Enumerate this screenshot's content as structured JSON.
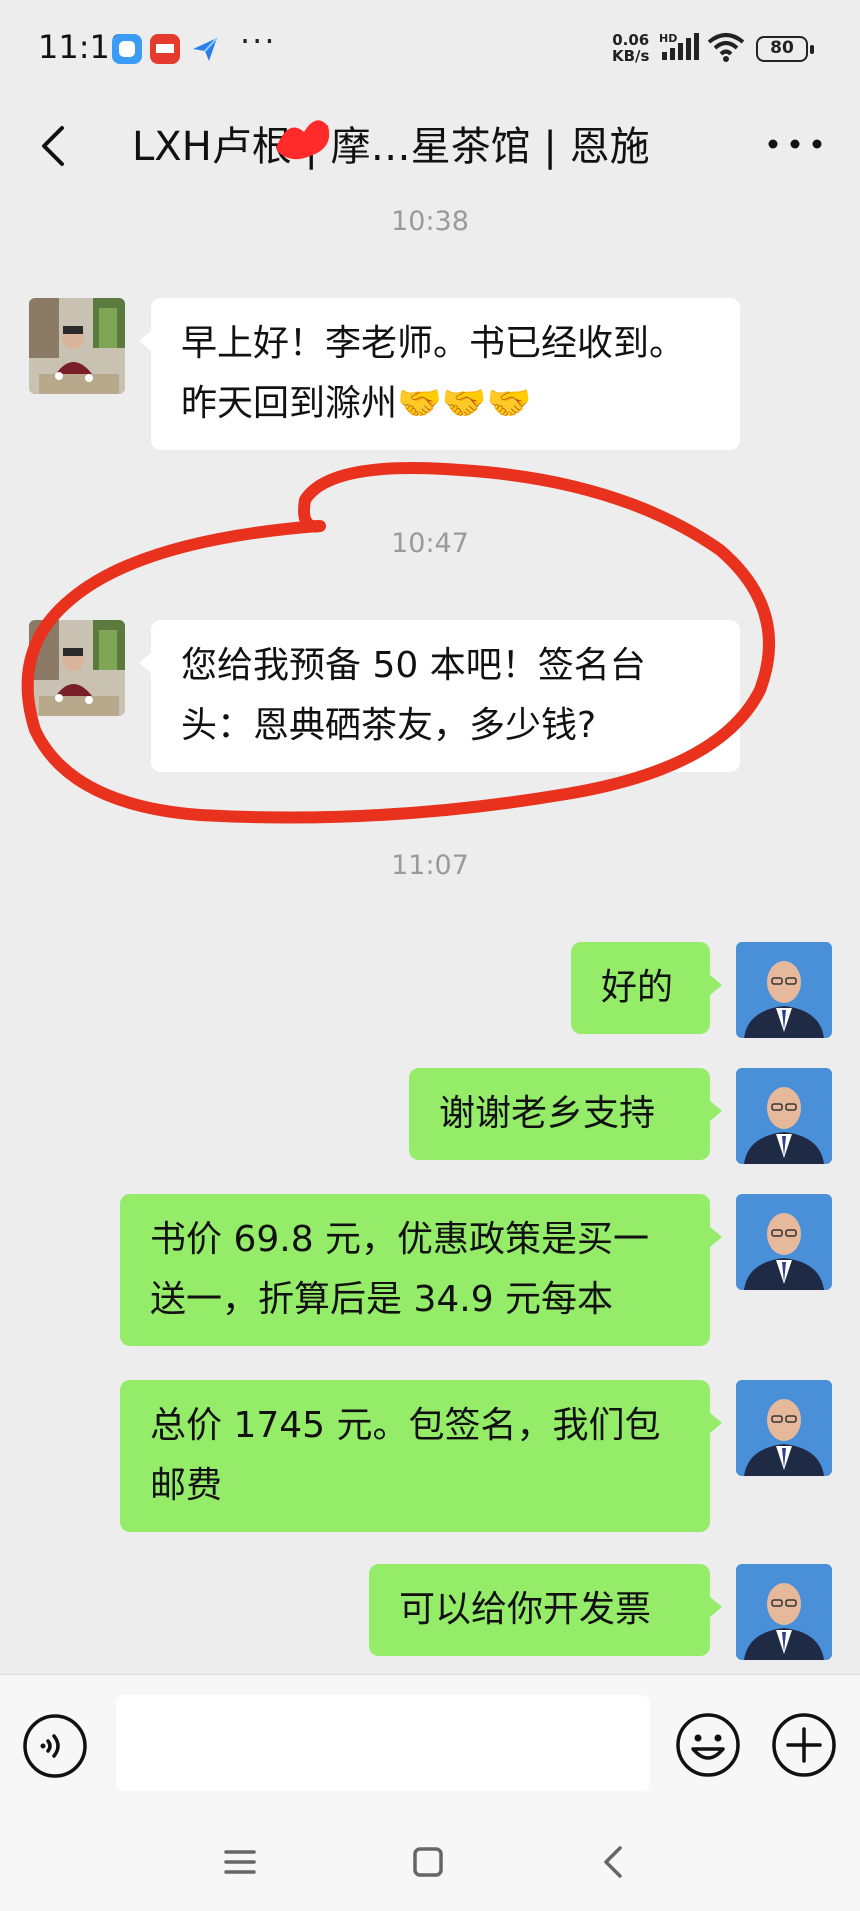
{
  "status_bar": {
    "time": "11:18",
    "speed_value": "0.06",
    "speed_unit": "KB/s",
    "network_badge": "HD",
    "battery": "80"
  },
  "header": {
    "title": "LXH卢根 | 摩…星茶馆 | 恩施"
  },
  "messages": [
    {
      "type": "time",
      "text": "10:38"
    },
    {
      "type": "in",
      "text": "早上好！李老师。书已经收到。\n昨天回到滁州🤝🤝🤝"
    },
    {
      "type": "time",
      "text": "10:47"
    },
    {
      "type": "in",
      "text": "您给我预备 50 本吧！签名台\n头：恩典硒茶友，多少钱?"
    },
    {
      "type": "time",
      "text": "11:07"
    },
    {
      "type": "out",
      "text": "好的"
    },
    {
      "type": "out",
      "text": "谢谢老乡支持"
    },
    {
      "type": "out",
      "text": "书价 69.8 元，优惠政策是买一\n送一，折算后是 34.9 元每本"
    },
    {
      "type": "out",
      "text": "总价 1745 元。包签名，我们包\n邮费"
    },
    {
      "type": "out",
      "text": "可以给你开发票"
    }
  ],
  "icons": {
    "back": "chevron-left-icon",
    "more": "more-dots-icon",
    "voice": "voice-icon",
    "emoji": "emoji-icon",
    "plus": "plus-icon"
  },
  "colors": {
    "out_bubble": "#95ec69",
    "in_bubble": "#ffffff",
    "background": "#ededed",
    "annotation": "#e8321e"
  }
}
